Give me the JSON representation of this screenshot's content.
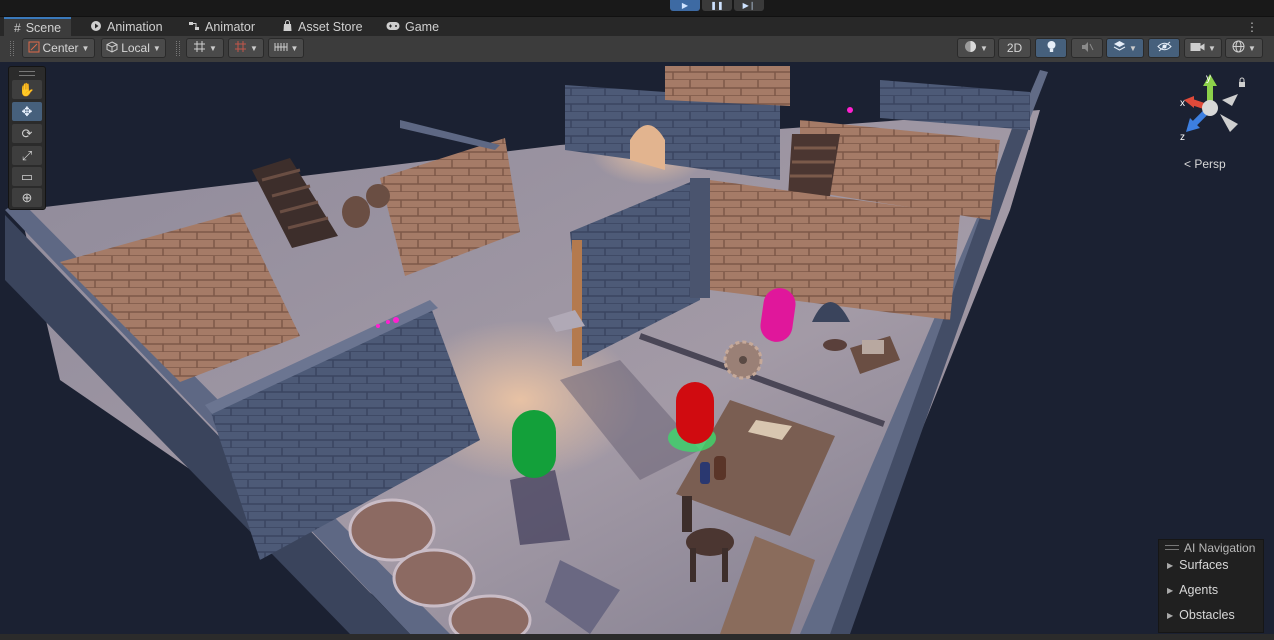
{
  "play_controls": {
    "play": "▶",
    "pause": "❚❚",
    "step": "▶❘"
  },
  "tabs": [
    {
      "label": "Scene",
      "icon": "hash-icon"
    },
    {
      "label": "Animation",
      "icon": "animation-icon"
    },
    {
      "label": "Animator",
      "icon": "animator-icon"
    },
    {
      "label": "Asset Store",
      "icon": "store-icon"
    },
    {
      "label": "Game",
      "icon": "gamepad-icon"
    }
  ],
  "toolbar": {
    "pivot_mode": "Center",
    "pivot_rotation": "Local",
    "mode_2d": "2D"
  },
  "tools": [
    "hand-tool",
    "move-tool",
    "rotate-tool",
    "scale-tool",
    "rect-tool",
    "transform-tool"
  ],
  "gizmo": {
    "x": "x",
    "y": "y",
    "z": "z",
    "projection": "Persp"
  },
  "ai_navigation": {
    "title": "AI Navigation",
    "items": [
      "Surfaces",
      "Agents",
      "Obstacles"
    ]
  },
  "colors": {
    "accent": "#3a79bb",
    "agent_pink": "#e0179b",
    "agent_red": "#d00b10",
    "agent_green": "#13a03a"
  }
}
